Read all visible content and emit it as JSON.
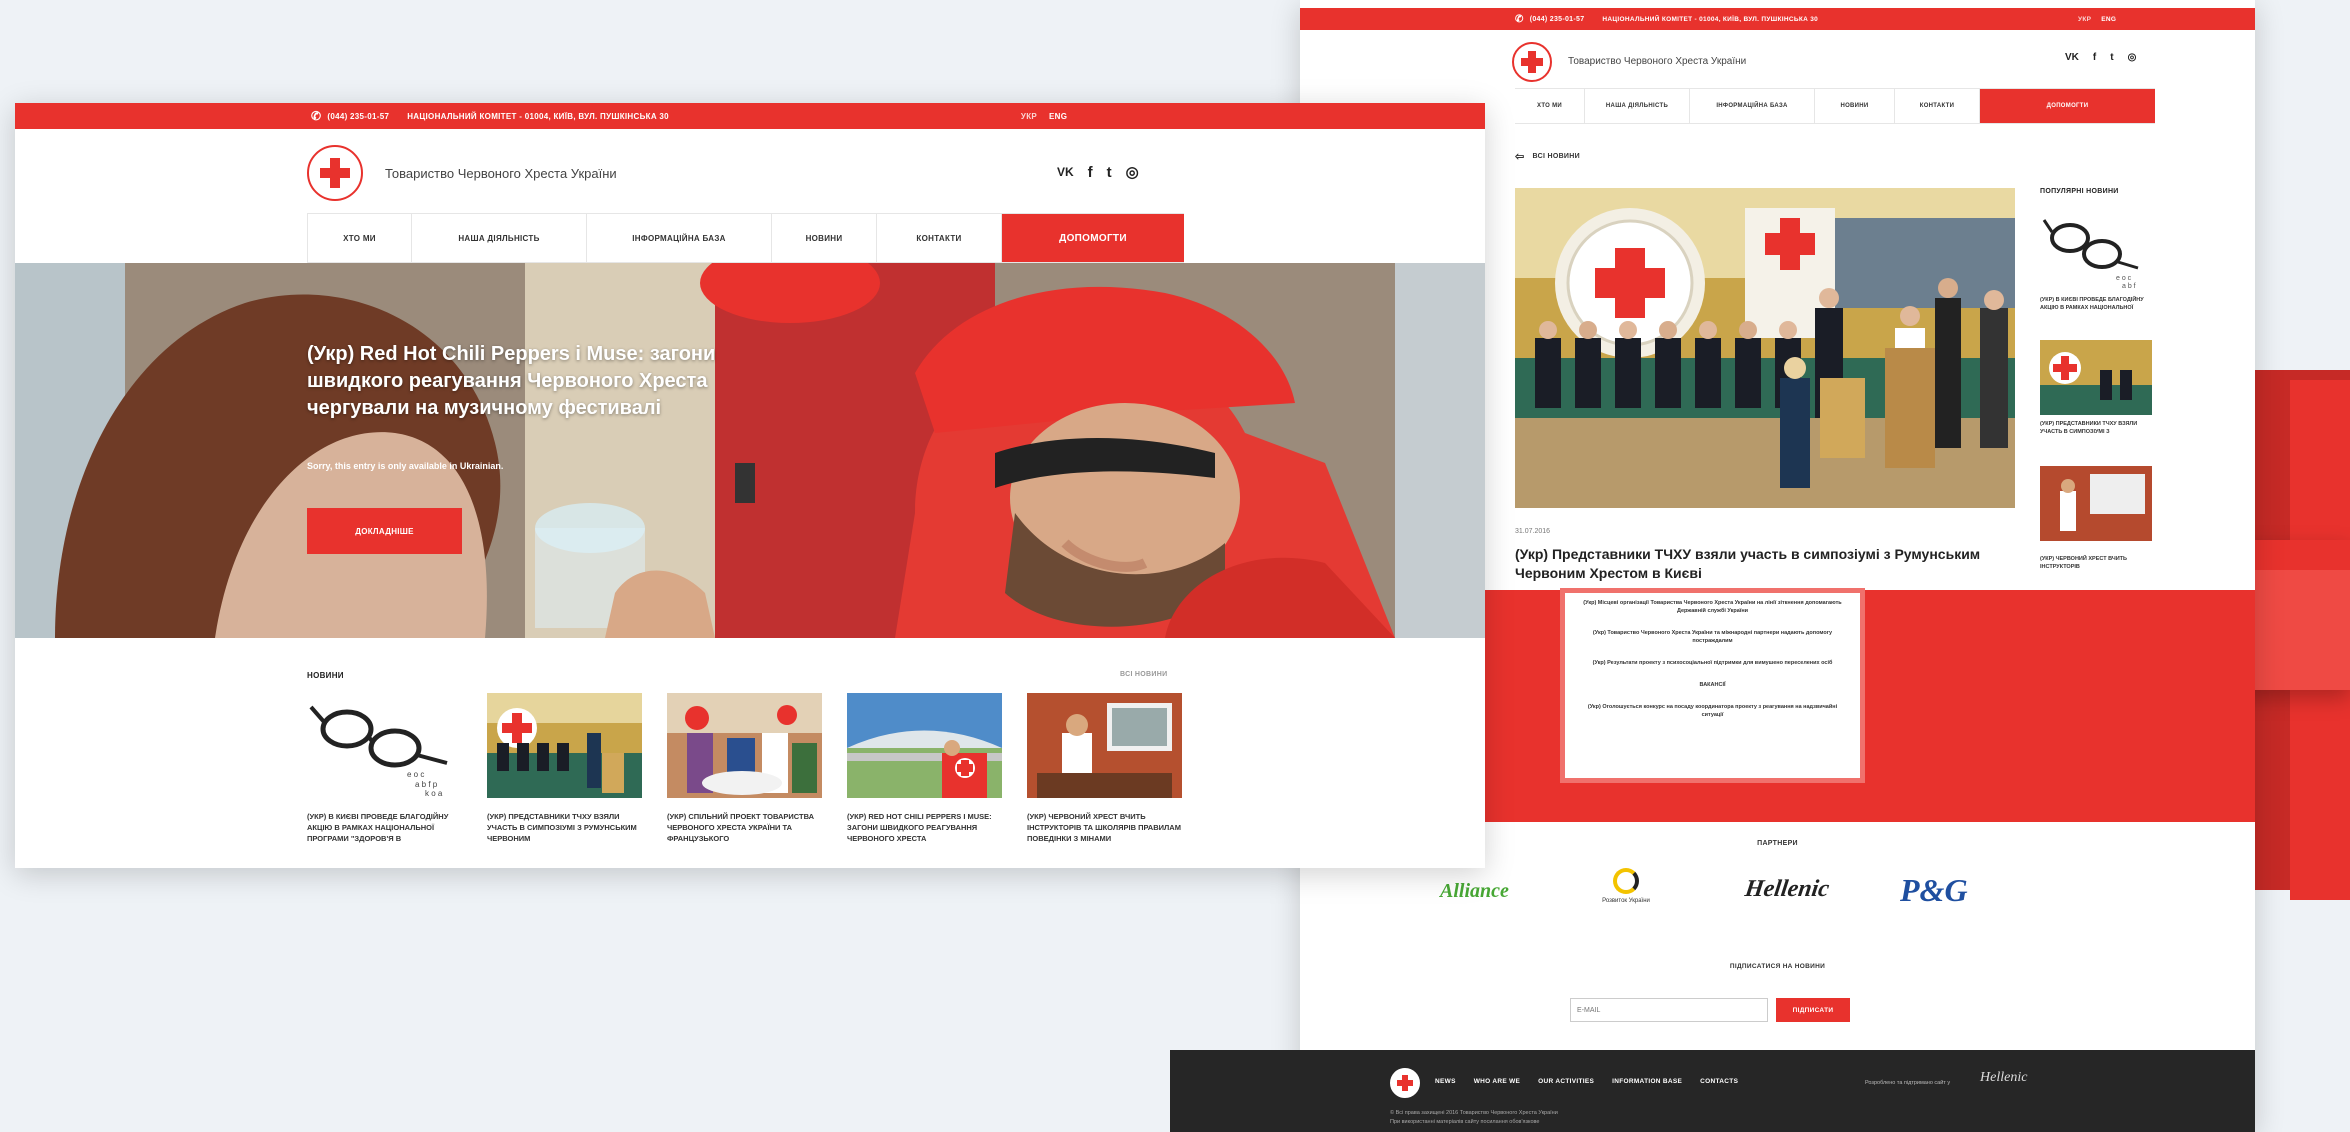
{
  "colors": {
    "brand_red": "#e8322d",
    "dark_footer": "#262626",
    "page_bg": "#eef2f6"
  },
  "left_window": {
    "topbar": {
      "phone": "(044) 235-01-57",
      "address": "НАЦІОНАЛЬНИЙ КОМІТЕТ - 01004, КИЇВ, ВУЛ. ПУШКІНСЬКА 30",
      "lang_ukr": "УКР",
      "lang_eng": "ENG"
    },
    "org_name": "Товариство Червоного Хреста України",
    "social": [
      "vk-icon",
      "facebook-icon",
      "twitter-icon",
      "instagram-icon"
    ],
    "social_glyphs": {
      "vk": "VK",
      "fb": "f",
      "tw": "t",
      "ig": "◎"
    },
    "nav": [
      "ХТО МИ",
      "НАША ДІЯЛЬНІСТЬ",
      "ІНФОРМАЦІЙНА БАЗА",
      "НОВИНИ",
      "КОНТАКТИ",
      "ДОПОМОГТИ"
    ],
    "hero": {
      "title": "(Укр) Red Hot Chili Peppers і Muse: загони швидкого реагування Червоного Хреста чергували на музичному фестивалі",
      "subtitle": "Sorry, this entry is only available in Ukrainian.",
      "button": "ДОКЛАДНІШЕ"
    },
    "news_heading": "НОВИНИ",
    "all_news": "ВСІ НОВИНИ",
    "news": [
      "(УКР) В КИЄВІ ПРОВЕДЕ БЛАГОДІЙНУ АКЦІЮ В РАМКАХ НАЦІОНАЛЬНОЇ ПРОГРАМИ \"ЗДОРОВ'Я В",
      "(УКР) ПРЕДСТАВНИКИ ТЧХУ ВЗЯЛИ УЧАСТЬ В СИМПОЗІУМІ З РУМУНСЬКИМ ЧЕРВОНИМ",
      "(УКР) СПІЛЬНИЙ ПРОЕКТ ТОВАРИСТВА ЧЕРВОНОГО ХРЕСТА УКРАЇНИ ТА ФРАНЦУЗЬКОГО",
      "(УКР) RED HOT CHILI PEPPERS І MUSE: ЗАГОНИ ШВИДКОГО РЕАГУВАННЯ ЧЕРВОНОГО ХРЕСТА",
      "(УКР) ЧЕРВОНИЙ ХРЕСТ ВЧИТЬ ІНСТРУКТОРІВ ТА ШКОЛЯРІВ ПРАВИЛАМ ПОВЕДІНКИ З МІНАМИ"
    ]
  },
  "right_window": {
    "topbar": {
      "phone": "(044) 235-01-57",
      "address": "НАЦІОНАЛЬНИЙ КОМІТЕТ - 01004, КИЇВ, ВУЛ. ПУШКІНСЬКА 30",
      "lang_ukr": "УКР",
      "lang_eng": "ENG"
    },
    "org_name": "Товариство Червоного Хреста України",
    "nav": [
      "ХТО МИ",
      "НАША ДІЯЛЬНІСТЬ",
      "ІНФОРМАЦІЙНА БАЗА",
      "НОВИНИ",
      "КОНТАКТИ",
      "ДОПОМОГТИ"
    ],
    "back": "ВСІ НОВИНИ",
    "back_icon": "arrow-left-icon",
    "article": {
      "date": "31.07.2016",
      "title": "(Укр) Представники ТЧХУ взяли участь в симпозіумі з Румунським Червоним Хрестом в Києві"
    },
    "sidebar_heading": "ПОПУЛЯРНІ НОВИНИ",
    "sidebar_items": [
      "(УКР) В КИЄВІ ПРОВЕДЕ БЛАГОДІЙНУ АКЦІЮ В РАМКАХ НАЦІОНАЛЬНОЇ",
      "(УКР) ПРЕДСТАВНИКИ ТЧХУ ВЗЯЛИ УЧАСТЬ В СИМПОЗІУМІ З",
      "(УКР) ЧЕРВОНИЙ ХРЕСТ ВЧИТЬ ІНСТРУКТОРІВ"
    ],
    "red_box_lines": [
      "(Укр) Місцеві організації Товариства Червоного Хреста України на лінії зіткнення допомагають Державній службі України",
      "(Укр) Товариство Червоного Хреста України та міжнародні партнери надають допомогу постраждалим",
      "(Укр) Результати проекту з психосоціальної підтримки для вимушено переселених осіб",
      "ВАКАНСІЇ",
      "(Укр) Оголошується конкурс на посаду координатора проекту з реагування на надзвичайні ситуації"
    ],
    "partners_heading": "ПАРТНЕРИ",
    "partners": [
      "Alliance",
      "Розвиток України",
      "Hellenic",
      "P&G"
    ],
    "subscribe_heading": "ПІДПИСАТИСЯ НА НОВИНИ",
    "email_placeholder": "E-MAIL",
    "subscribe_button": "ПІДПИСАТИ",
    "footer_links": [
      "NEWS",
      "WHO ARE WE",
      "OUR ACTIVITIES",
      "INFORMATION BASE",
      "CONTACTS"
    ],
    "footer_dev": "Розроблено та підтримано сайт у",
    "footer_signature": "Hellenic",
    "footer_copy1": "© Всі права захищені 2016 Товариство Червоного Хреста України",
    "footer_copy2": "При використанні матеріалів сайту посилання обов'язкове"
  }
}
